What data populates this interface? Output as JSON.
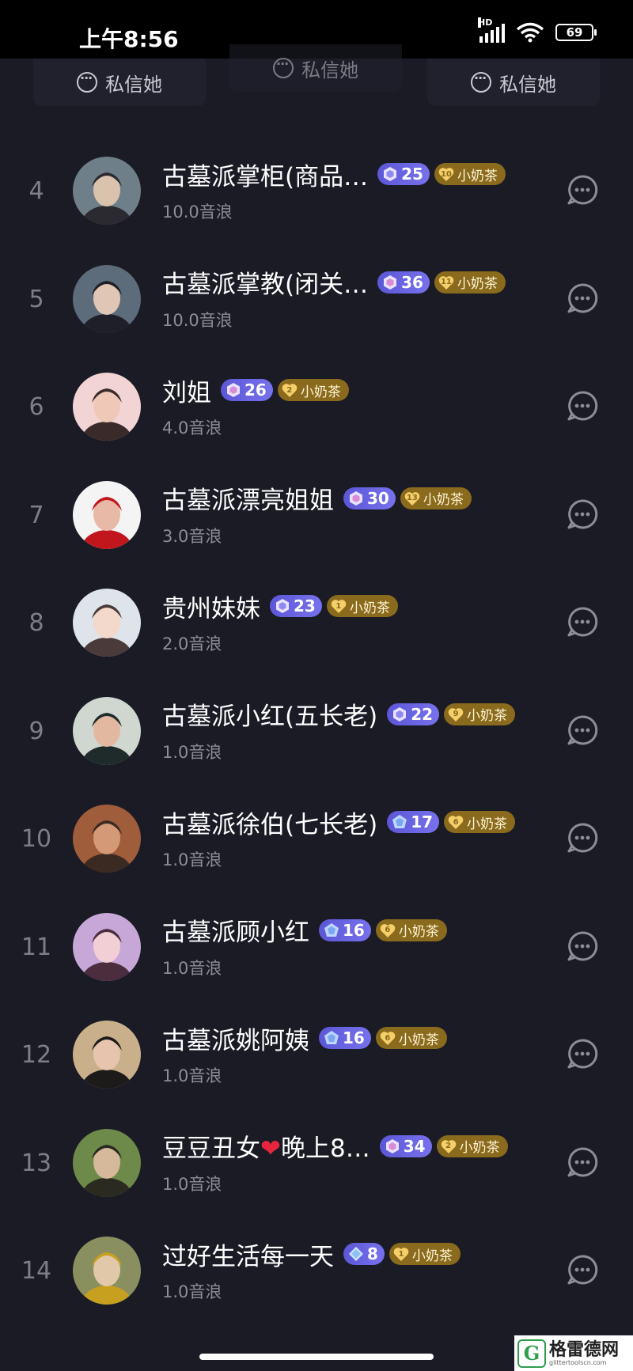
{
  "status_bar": {
    "time": "上午8:56",
    "network": "HD",
    "battery": "69"
  },
  "top_strip": {
    "dm_label": "私信她"
  },
  "list": [
    {
      "rank": "4",
      "name": "古墓派掌柜(商品…",
      "level": "25",
      "fan_level": "10",
      "fan_club": "小奶茶",
      "score": "10.0音浪",
      "gem": "hex",
      "avatar_colors": [
        "#6f7f8a",
        "#d9c3ad",
        "#2a2a30"
      ]
    },
    {
      "rank": "5",
      "name": "古墓派掌教(闭关…",
      "level": "36",
      "fan_level": "11",
      "fan_club": "小奶茶",
      "score": "10.0音浪",
      "gem": "hex-pink",
      "avatar_colors": [
        "#5d6c7a",
        "#e0c6b5",
        "#1e1f28"
      ]
    },
    {
      "rank": "6",
      "name": "刘姐",
      "level": "26",
      "fan_level": "2",
      "fan_club": "小奶茶",
      "score": "4.0音浪",
      "gem": "hex-pink",
      "avatar_colors": [
        "#f2d4d4",
        "#f0c8b8",
        "#3b2a2a"
      ]
    },
    {
      "rank": "7",
      "name": "古墓派漂亮姐姐",
      "level": "30",
      "fan_level": "13",
      "fan_club": "小奶茶",
      "score": "3.0音浪",
      "gem": "hex-pink",
      "avatar_colors": [
        "#f4f4f4",
        "#e7b9a6",
        "#c0161c"
      ]
    },
    {
      "rank": "8",
      "name": "贵州妹妹",
      "level": "23",
      "fan_level": "1",
      "fan_club": "小奶茶",
      "score": "2.0音浪",
      "gem": "hex",
      "avatar_colors": [
        "#dfe3ea",
        "#f3d8cc",
        "#4a3a3a"
      ]
    },
    {
      "rank": "9",
      "name": "古墓派小红(五长老)",
      "level": "22",
      "fan_level": "9",
      "fan_club": "小奶茶",
      "score": "1.0音浪",
      "gem": "hex",
      "avatar_colors": [
        "#cfd7d0",
        "#e2b8a0",
        "#1f2b2a"
      ]
    },
    {
      "rank": "10",
      "name": "古墓派徐伯(七长老)",
      "level": "17",
      "fan_level": "6",
      "fan_club": "小奶茶",
      "score": "1.0音浪",
      "gem": "pent",
      "avatar_colors": [
        "#a05d3c",
        "#d49a78",
        "#3a2a22"
      ]
    },
    {
      "rank": "11",
      "name": "古墓派顾小红",
      "level": "16",
      "fan_level": "6",
      "fan_club": "小奶茶",
      "score": "1.0音浪",
      "gem": "pent",
      "avatar_colors": [
        "#c7a7d8",
        "#f1cfd5",
        "#4b2d3e"
      ]
    },
    {
      "rank": "12",
      "name": "古墓派姚阿姨",
      "level": "16",
      "fan_level": "6",
      "fan_club": "小奶茶",
      "score": "1.0音浪",
      "gem": "pent",
      "avatar_colors": [
        "#c9b08a",
        "#e6c4ae",
        "#1d1a1a"
      ]
    },
    {
      "rank": "13",
      "name_prefix": "豆豆丑女",
      "name_heart": "❤",
      "name_suffix": "晚上8…",
      "level": "34",
      "fan_level": "2",
      "fan_club": "小奶茶",
      "score": "1.0音浪",
      "gem": "hex-pink",
      "avatar_colors": [
        "#6d8a4a",
        "#d6b89b",
        "#2a2a20"
      ]
    },
    {
      "rank": "14",
      "name": "过好生活每一天",
      "level": "8",
      "fan_level": "1",
      "fan_club": "小奶茶",
      "score": "1.0音浪",
      "gem": "diamond",
      "avatar_colors": [
        "#8a8f60",
        "#e1c8a8",
        "#c8a020"
      ]
    }
  ],
  "watermark": {
    "logo": "G",
    "title": "格雷德网",
    "url": "glittertoolscn.com"
  },
  "colors": {
    "background": "#1a1b25",
    "level_badge": "#6a65e4",
    "fan_badge": "#8a6a1c",
    "subtext": "#8c8d97",
    "rank": "#7d7e88"
  }
}
